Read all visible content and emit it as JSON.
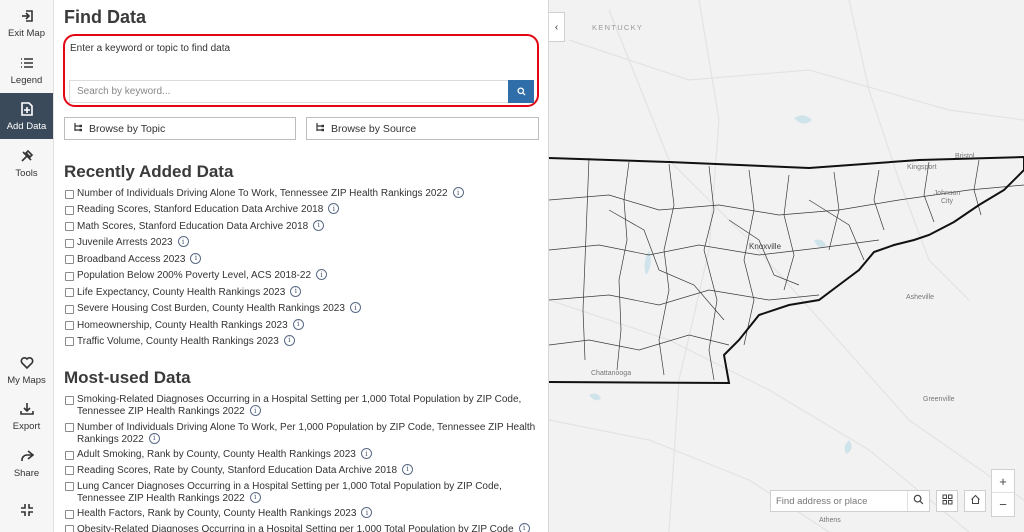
{
  "rail": {
    "exit_map": "Exit Map",
    "legend": "Legend",
    "add_data": "Add Data",
    "tools": "Tools",
    "my_maps": "My Maps",
    "export": "Export",
    "share": "Share"
  },
  "panel": {
    "title": "Find Data",
    "search_hint": "Enter a keyword or topic to find data",
    "search_placeholder": "Search by keyword...",
    "browse_topic": "Browse by Topic",
    "browse_source": "Browse by Source",
    "recent_title": "Recently Added Data",
    "recent": [
      "Number of Individuals Driving Alone To Work, Tennessee ZIP Health Rankings 2022",
      "Reading Scores, Stanford Education Data Archive 2018",
      "Math Scores, Stanford Education Data Archive 2018",
      "Juvenile Arrests 2023",
      "Broadband Access 2023",
      "Population Below 200% Poverty Level, ACS 2018-22",
      "Life Expectancy, County Health Rankings 2023",
      "Severe Housing Cost Burden, County Health Rankings 2023",
      "Homeownership, County Health Rankings 2023",
      "Traffic Volume, County Health Rankings 2023"
    ],
    "most_title": "Most-used Data",
    "most": [
      "Smoking-Related Diagnoses Occurring in a Hospital Setting per 1,000 Total Population by ZIP Code, Tennessee ZIP Health Rankings 2022",
      "Number of Individuals Driving Alone To Work, Per 1,000 Population by ZIP Code, Tennessee ZIP Health Rankings 2022",
      "Adult Smoking, Rank by County, County Health Rankings 2023",
      "Reading Scores, Rate by County, Stanford Education Data Archive 2018",
      "Lung Cancer Diagnoses Occurring in a Hospital Setting per 1,000 Total Population by ZIP Code, Tennessee ZIP Health Rankings 2022",
      "Health Factors, Rank by County, County Health Rankings 2023",
      "Obesity-Related Diagnoses Occurring in a Hospital Setting per 1,000 Total Population by ZIP Code"
    ]
  },
  "map": {
    "kentucky": "KENTUCKY",
    "knoxville": "Knoxville",
    "bristol": "Bristol",
    "kingsport": "Kingsport",
    "johnson_city": "Johnson City",
    "asheville": "Asheville",
    "chattanooga": "Chattanooga",
    "greenville": "Greenville",
    "athens": "Athens",
    "address_placeholder": "Find address or place",
    "zoom_in": "+",
    "zoom_out": "−"
  }
}
